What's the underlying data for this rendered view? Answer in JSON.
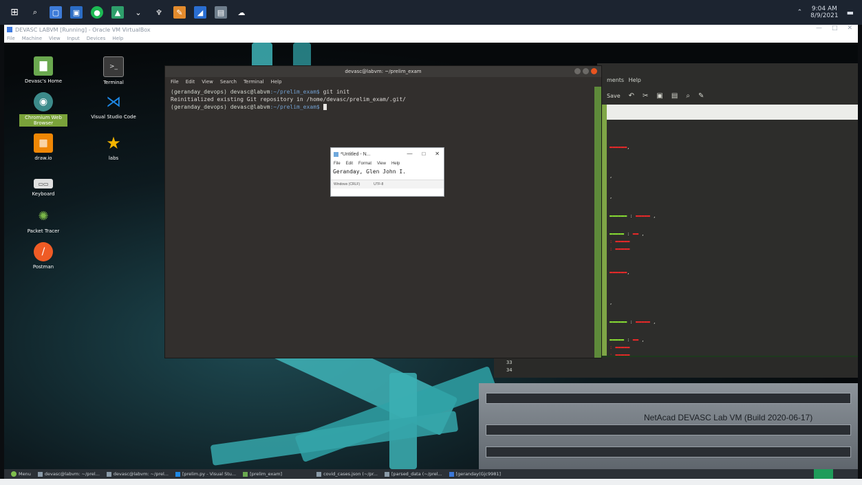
{
  "host": {
    "clock_time": "9:04 AM",
    "clock_date": "8/9/2021",
    "window_title": "DEVASC LABVM [Running] - Oracle VM VirtualBox",
    "menu": [
      "File",
      "Machine",
      "View",
      "Input",
      "Devices",
      "Help"
    ],
    "controls": [
      "—",
      "□",
      "✕"
    ]
  },
  "desktop_icons": [
    {
      "label": "Devasc's Home",
      "icon": "folder-icon",
      "color": "#6aa84f"
    },
    {
      "label": "Terminal",
      "icon": "terminal-icon",
      "color": "#3a3a3a"
    },
    {
      "label": "Chromium Web Browser",
      "icon": "chromium-icon",
      "color": "#3c8a8a"
    },
    {
      "label": "Visual Studio Code",
      "icon": "vscode-icon",
      "color": "#1e88e5"
    },
    {
      "label": "draw.io",
      "icon": "drawio-icon",
      "color": "#f08705"
    },
    {
      "label": "labs",
      "icon": "star-icon",
      "color": "#f4b400"
    },
    {
      "label": "Keyboard",
      "icon": "keyboard-icon",
      "color": "#e0e0e0"
    },
    {
      "label": "Packet Tracer",
      "icon": "packet-tracer-icon",
      "color": "#4a7f3a"
    },
    {
      "label": "Postman",
      "icon": "postman-icon",
      "color": "#ef5b25"
    }
  ],
  "terminal": {
    "title": "devasc@labvm: ~/prelim_exam",
    "menu": [
      "File",
      "Edit",
      "View",
      "Search",
      "Terminal",
      "Help"
    ],
    "lines": [
      {
        "user": "(geranday_devops) devasc@labvm",
        "path": ":~/prelim_exam$",
        "text": " git init"
      },
      {
        "user": "",
        "path": "",
        "text": "Reinitialized existing Git repository in /home/devasc/prelim_exam/.git/"
      },
      {
        "user": "(geranday_devops) devasc@labvm",
        "path": ":~/prelim_exam$",
        "text": " "
      }
    ]
  },
  "notepad": {
    "title": "*Untitled - N...",
    "menu": [
      "File",
      "Edit",
      "Format",
      "View",
      "Help"
    ],
    "text": "Geranday, Glen John I.",
    "status_encoding": "Windows (CRLF)",
    "status_charset": "UTF-8"
  },
  "editor": {
    "menu": [
      "ments",
      "Help"
    ],
    "toolbar_label": "Save",
    "lower_lines": [
      "33",
      "34"
    ]
  },
  "server_label": "NetAcad DEVASC Lab VM (Build 2020-06-17)",
  "guest_taskbar": {
    "menu": "Menu",
    "items": [
      "devasc@labvm: ~/prel...",
      "devasc@labvm: ~/prel...",
      "[prelim.py - Visual Stu...",
      "[prelim_exam]",
      "covid_cases.json (~/pr...",
      "[parsed_data (~/prel...",
      "[geranday(Gjc9981]"
    ]
  }
}
